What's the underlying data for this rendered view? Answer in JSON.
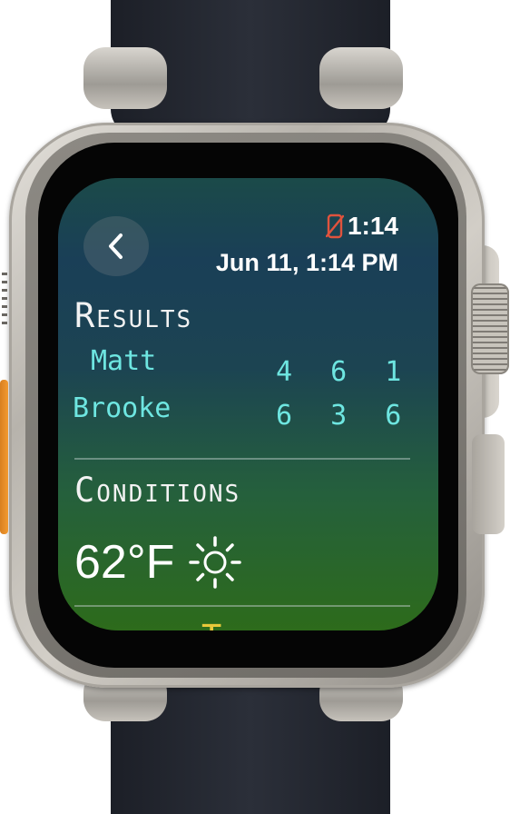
{
  "status": {
    "time": "1:14",
    "date": "Jun 11, 1:14 PM",
    "phone_status_icon": "phone-disconnected-icon",
    "phone_status_color": "#e0533d"
  },
  "back_icon": "chevron-left-icon",
  "results": {
    "title": "Results",
    "players": [
      {
        "name": "Matt",
        "scores": "4 6 1"
      },
      {
        "name": "Brooke",
        "scores": "6 3 6"
      }
    ]
  },
  "conditions": {
    "title": "Conditions",
    "temperature": "62°F",
    "weather_icon": "sun-icon"
  },
  "next_section": {
    "title_partial": "Time"
  },
  "colors": {
    "accent_cyan": "#6ee6e1",
    "time_gold": "#e8c83a"
  }
}
